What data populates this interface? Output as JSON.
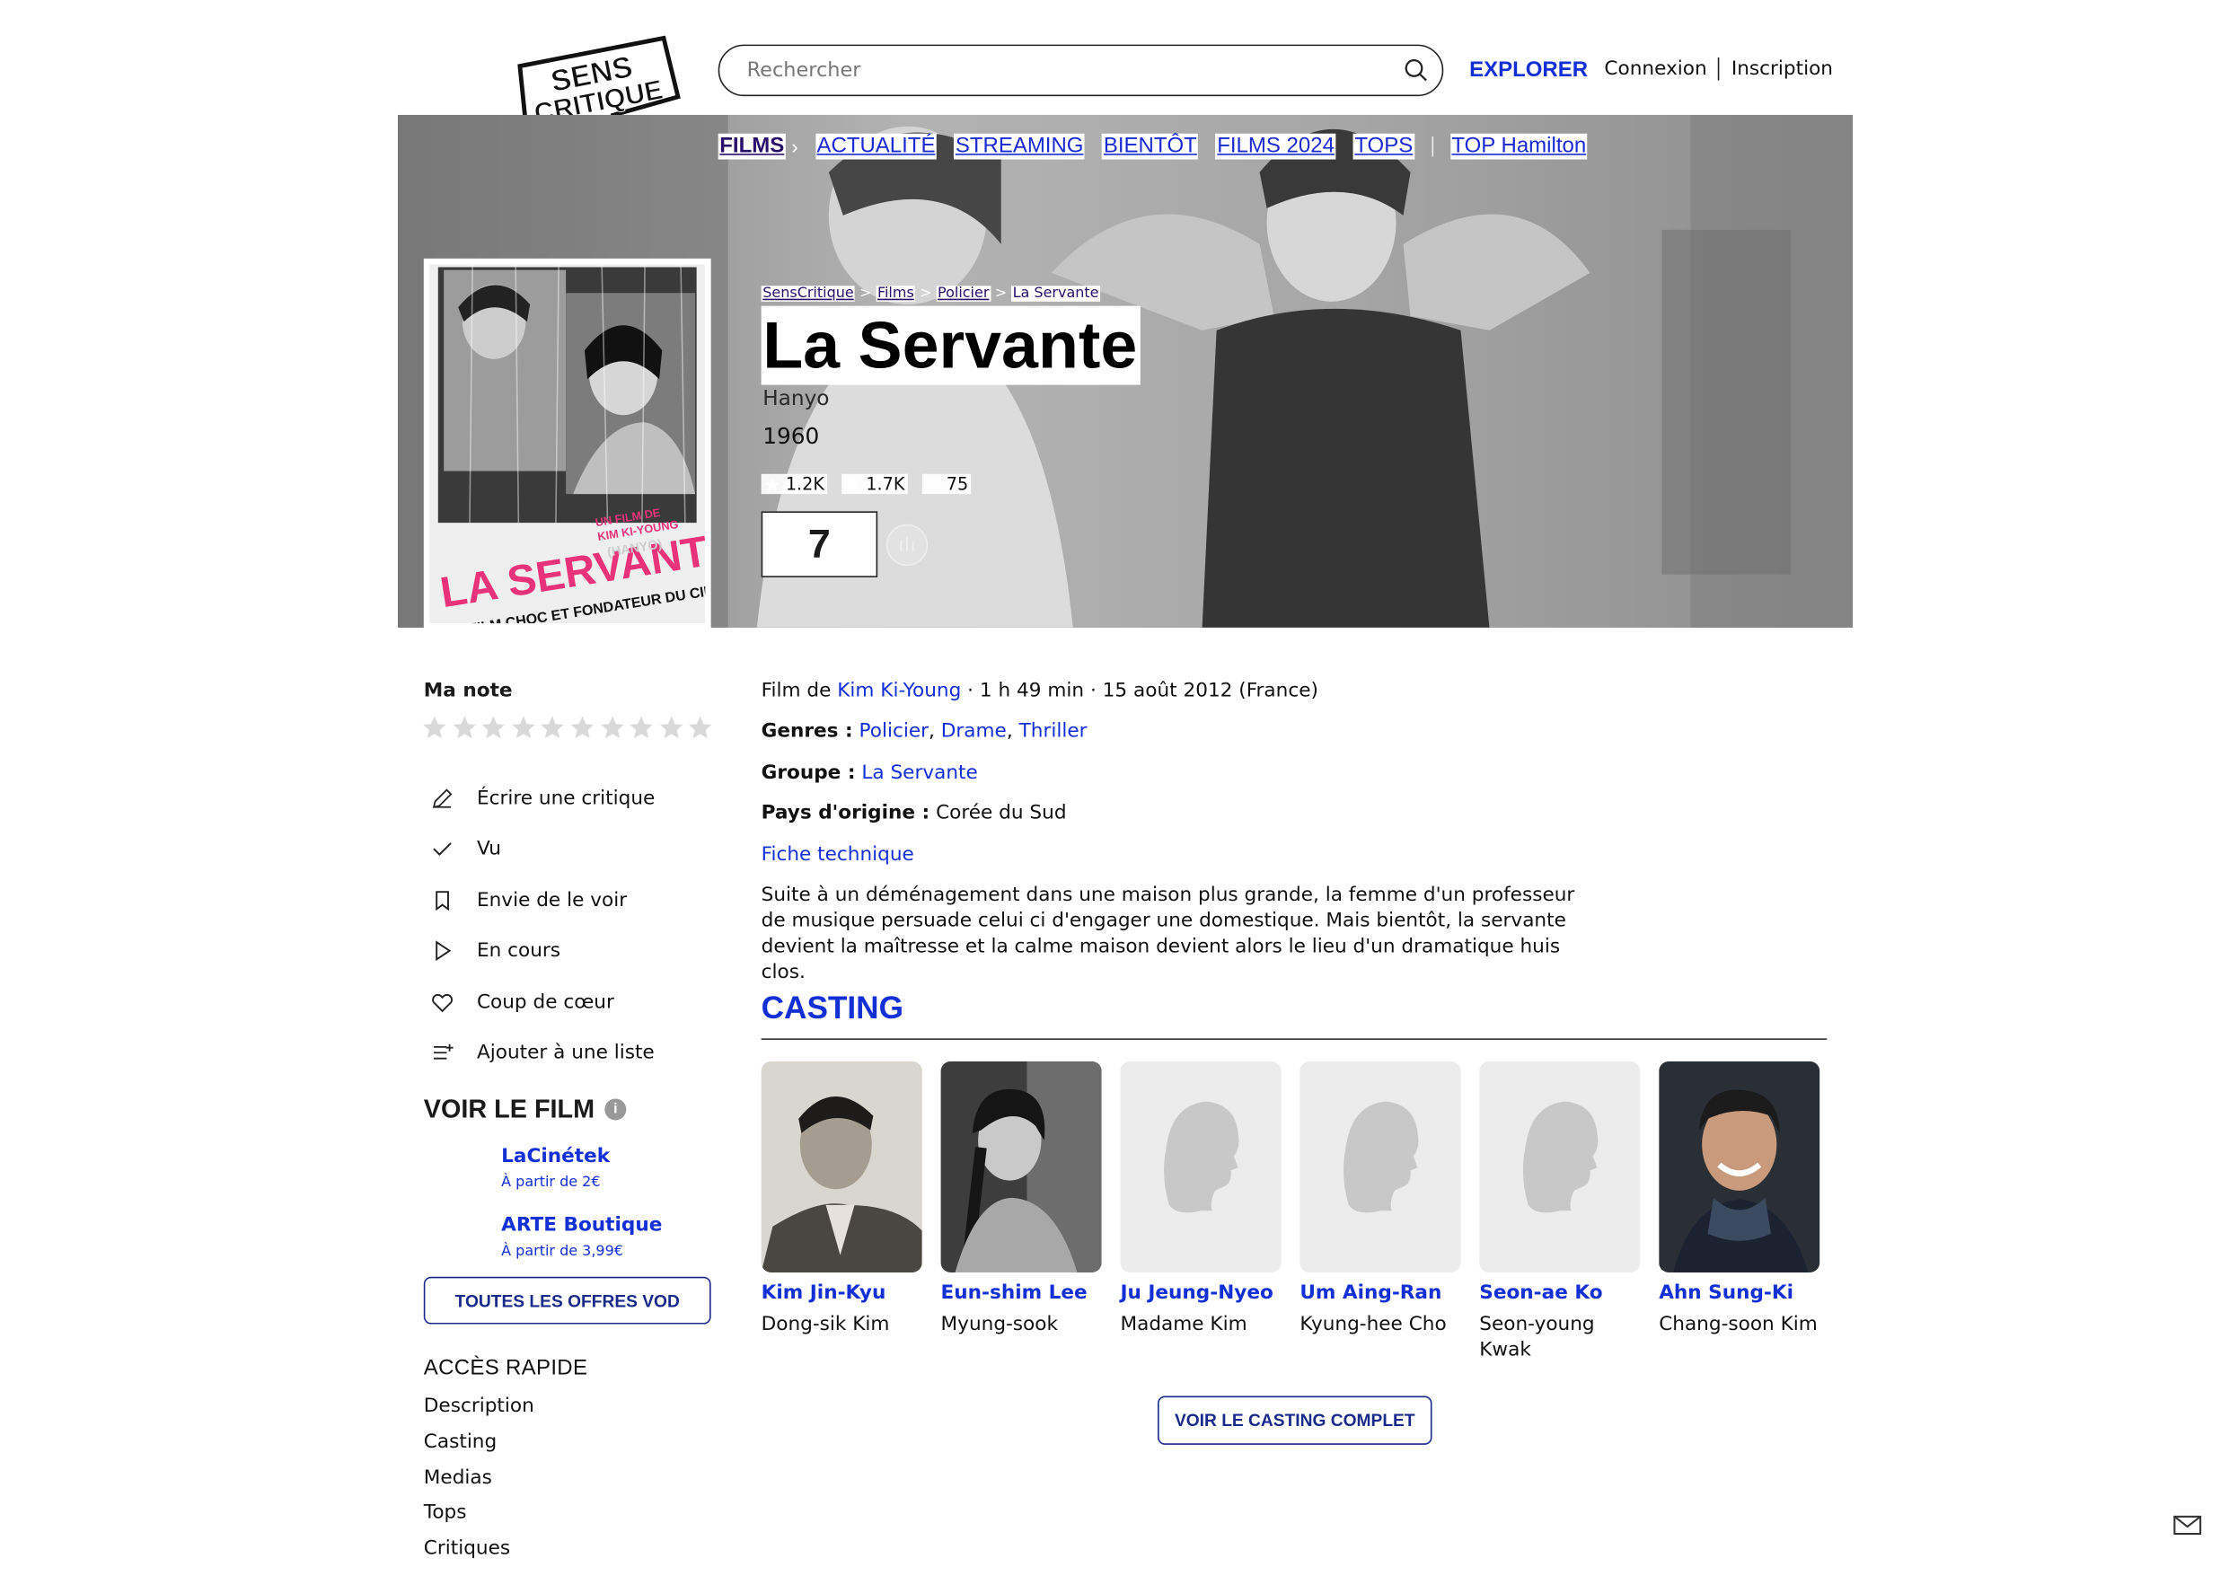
{
  "header": {
    "logo_line1": "SENS",
    "logo_line2": "CRITIQUE",
    "search_placeholder": "Rechercher",
    "explorer": "EXPLORER",
    "login": "Connexion",
    "signup": "Inscription"
  },
  "nav": {
    "films": "FILMS",
    "items": [
      "ACTUALITÉ",
      "STREAMING",
      "BIENTÔT",
      "FILMS 2024",
      "TOPS"
    ],
    "extra": "TOP Hamilton"
  },
  "poster": {
    "title_text": "LA SERVANTE",
    "subtitle_text": "UN FILM CHOC ET FONDATEUR DU CINÉMA CORÉEN",
    "credit_text": "UN FILM DE KIM KI-YOUNG",
    "paren": "(HANYO)",
    "accent_color": "#e8337a"
  },
  "breadcrumb": [
    "SensCritique",
    "Films",
    "Policier",
    "La Servante"
  ],
  "movie": {
    "title": "La Servante",
    "original_title": "Hanyo",
    "year": "1960",
    "stats": {
      "ratings": "1.2K",
      "wishlist": "1.7K",
      "favorites": "75"
    },
    "score": "7"
  },
  "sidebar": {
    "my_rating_label": "Ma note",
    "star_count": 10,
    "actions": [
      {
        "label": "Écrire une critique",
        "icon": "pencil-icon"
      },
      {
        "label": "Vu",
        "icon": "check-icon"
      },
      {
        "label": "Envie de le voir",
        "icon": "bookmark-icon"
      },
      {
        "label": "En cours",
        "icon": "play-icon"
      },
      {
        "label": "Coup de cœur",
        "icon": "heart-icon"
      },
      {
        "label": "Ajouter à une liste",
        "icon": "list-add-icon"
      }
    ],
    "voir_title": "VOIR LE FILM",
    "vod": [
      {
        "name": "LaCinétek",
        "price": "À partir de 2€"
      },
      {
        "name": "ARTE Boutique",
        "price": "À partir de 3,99€"
      }
    ],
    "vod_button": "TOUTES LES OFFRES VOD",
    "acces_title": "ACCÈS RAPIDE",
    "quick_links": [
      "Description",
      "Casting",
      "Medias",
      "Tops",
      "Critiques"
    ]
  },
  "details": {
    "film_de": "Film de",
    "director": "Kim Ki-Young",
    "meta": " · 1 h 49 min · 15 août 2012 (France)",
    "genres_label": "Genres :",
    "genres": [
      "Policier",
      "Drame",
      "Thriller"
    ],
    "groupe_label": "Groupe :",
    "groupe": "La Servante",
    "pays_label": "Pays d'origine :",
    "pays": "Corée du Sud",
    "fiche": "Fiche technique",
    "synopsis": "Suite à un déménagement dans une maison plus grande, la femme d'un professeur de musique persuade celui ci d'engager une domestique. Mais bientôt, la servante devient la maîtresse et la calme maison devient alors le lieu d'un dramatique huis clos."
  },
  "casting": {
    "title": "CASTING",
    "members": [
      {
        "name": "Kim Jin-Kyu",
        "role": "Dong-sik Kim",
        "photo": "man-portrait"
      },
      {
        "name": "Eun-shim Lee",
        "role": "Myung-sook",
        "photo": "woman-portrait"
      },
      {
        "name": "Ju Jeung-Nyeo",
        "role": "Madame Kim",
        "photo": "placeholder"
      },
      {
        "name": "Um Aing-Ran",
        "role": "Kyung-hee Cho",
        "photo": "placeholder"
      },
      {
        "name": "Seon-ae Ko",
        "role": "Seon-young Kwak",
        "photo": "placeholder"
      },
      {
        "name": "Ahn Sung-Ki",
        "role": "Chang-soon Kim",
        "photo": "smiling-man-portrait"
      }
    ],
    "button": "VOIR LE CASTING COMPLET"
  },
  "colors": {
    "accent": "#1230d6",
    "dark_accent": "#2a0f6a"
  }
}
